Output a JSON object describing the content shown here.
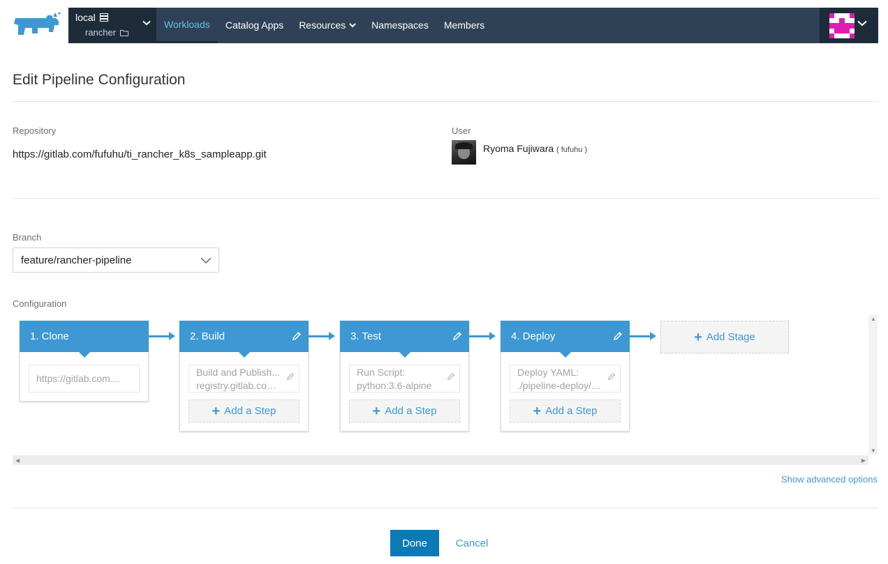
{
  "header": {
    "cluster_name": "local",
    "project_name": "rancher",
    "nav": [
      {
        "label": "Workloads",
        "active": true
      },
      {
        "label": "Catalog Apps"
      },
      {
        "label": "Resources",
        "dropdown": true
      },
      {
        "label": "Namespaces"
      },
      {
        "label": "Members"
      }
    ],
    "icons": {
      "logo": "rancher-logo-icon",
      "cluster": "server-icon",
      "project": "folder-icon",
      "chevron": "chevron-down-icon",
      "avatar": "identicon-avatar"
    },
    "colors": {
      "nav_bg": "#2f4156",
      "nav_dark": "#1e2b39",
      "active": "#5fc3e4",
      "avatar": "#e01cb6"
    }
  },
  "page": {
    "title": "Edit Pipeline Configuration",
    "repository_label": "Repository",
    "repository_url": "https://gitlab.com/fufuhu/ti_rancher_k8s_sampleapp.git",
    "user_label": "User",
    "user_name": "Ryoma Fujiwara",
    "user_handle": "( fufuhu )",
    "branch_label": "Branch",
    "branch_value": "feature/rancher-pipeline",
    "configuration_label": "Configuration"
  },
  "stages": [
    {
      "name": "1. Clone",
      "editable": false,
      "steps": [
        {
          "lines": [
            "https://gitlab.com/f..."
          ]
        }
      ],
      "add_step": false
    },
    {
      "name": "2. Build",
      "editable": true,
      "steps": [
        {
          "lines": [
            "Build and Publish...",
            "registry.gitlab.com/..."
          ]
        }
      ],
      "add_step": true
    },
    {
      "name": "3. Test",
      "editable": true,
      "steps": [
        {
          "lines": [
            "Run Script:",
            "python:3.6-alpine"
          ]
        }
      ],
      "add_step": true
    },
    {
      "name": "4. Deploy",
      "editable": true,
      "steps": [
        {
          "lines": [
            "Deploy YAML:",
            "./pipeline-deploy/p..."
          ]
        }
      ],
      "add_step": true
    }
  ],
  "add_step_label": "Add a Step",
  "add_stage_label": "Add Stage",
  "advanced_link": "Show advanced options",
  "buttons": {
    "done": "Done",
    "cancel": "Cancel"
  },
  "colors": {
    "accent": "#3d98d3",
    "primary_button": "#0b7ab6"
  }
}
